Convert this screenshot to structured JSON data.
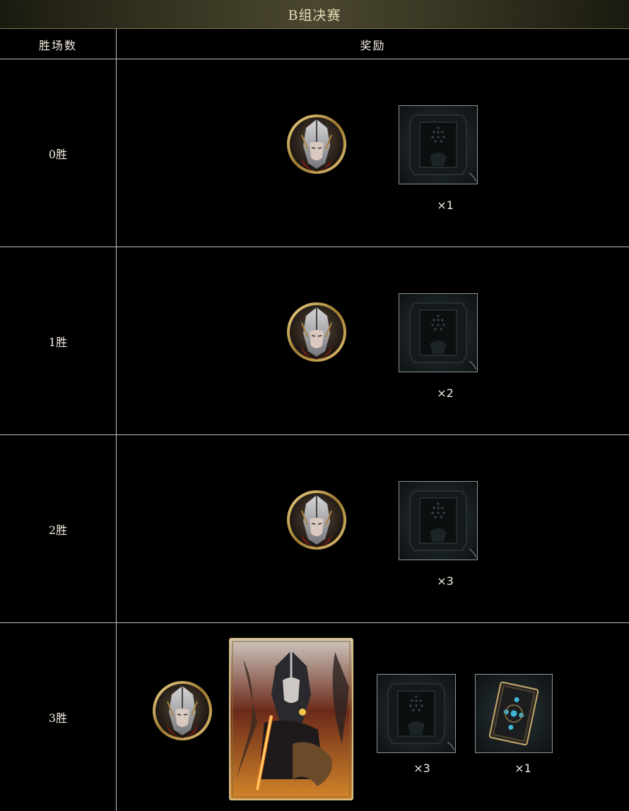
{
  "title": "B组决赛",
  "header": {
    "col_wins": "胜场数",
    "col_rewards": "奖励"
  },
  "rows": [
    {
      "wins": "0胜",
      "card_qty": "×1"
    },
    {
      "wins": "1胜",
      "card_qty": "×2"
    },
    {
      "wins": "2胜",
      "card_qty": "×3"
    },
    {
      "wins": "3胜",
      "card_qty": "×3",
      "deck_qty": "×1"
    }
  ],
  "colors": {
    "border": "#bdbdbd",
    "gold": "#c9a452",
    "title_text": "#e6dcb8"
  },
  "icons": [
    "knight-avatar-icon",
    "card-back-icon",
    "hero-card-icon",
    "deck-card-icon"
  ]
}
